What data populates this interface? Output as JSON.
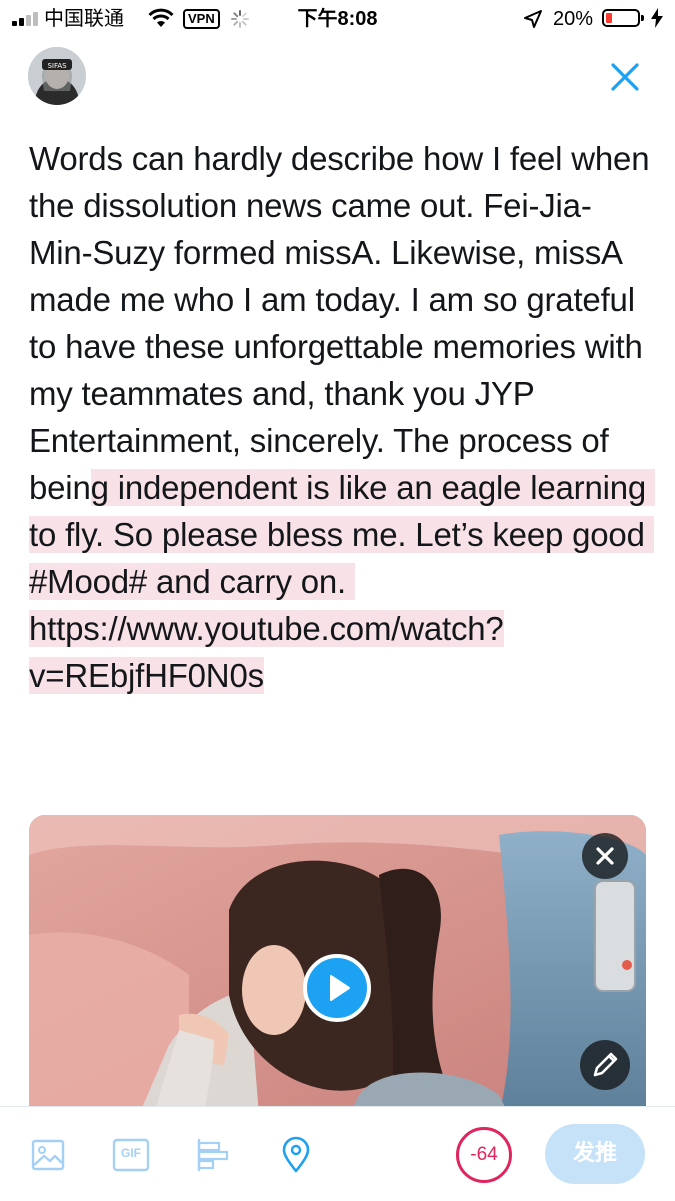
{
  "status_bar": {
    "carrier": "中国联通",
    "vpn_label": "VPN",
    "time": "下午8:08",
    "battery_percent": "20%",
    "battery_level": 0.2,
    "signal_icon": "signal-bars-icon",
    "wifi_icon": "wifi-icon",
    "location_icon": "location-arrow-icon",
    "charging_icon": "bolt-icon"
  },
  "header": {
    "avatar_icon": "user-avatar",
    "close_icon": "close-icon"
  },
  "compose": {
    "text_main": "Words can hardly describe how I feel when the dissolution news came out. Fei-Jia-Min-Suzy formed missA. Likewise, missA made me who I am today. I am so grateful to have these unforgettable memories with my teammates and, thank you JYP Entertainment, sincerely. The process of bein",
    "text_overflow": "g independent is like an eagle learning to fly. So please bless me. Let’s keep good #Mood# and carry on. https://www.youtube.com/watch?v=REbjfHF0N0s",
    "overflow_highlight_color": "#f9e1e8"
  },
  "media": {
    "close_icon": "close-icon",
    "edit_icon": "pencil-icon",
    "play_icon": "play-icon"
  },
  "toolbar": {
    "image_icon": "image-icon",
    "gif_label": "GIF",
    "poll_icon": "poll-icon",
    "location_icon": "location-pin-icon",
    "char_counter": "-64",
    "tweet_button": "发推",
    "accent_color": "#1da1f2",
    "error_color": "#e0245e"
  }
}
